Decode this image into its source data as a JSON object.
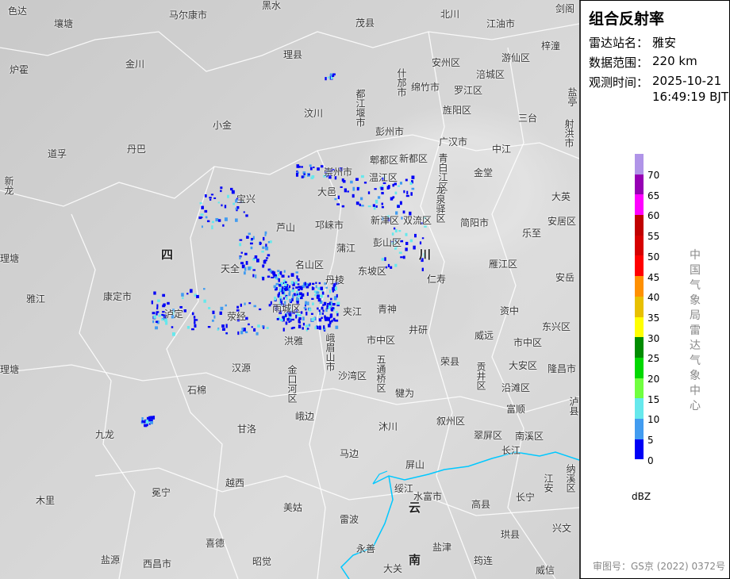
{
  "panel": {
    "title": "组合反射率",
    "station_label": "雷达站名：",
    "station": "雅安",
    "range_label": "数据范围：",
    "range": "220 km",
    "time_label": "观测时间：",
    "date": "2025-10-21",
    "time": "16:49:19 BJT",
    "legend": {
      "unit": "dBZ",
      "ticks": [
        "70",
        "65",
        "60",
        "55",
        "50",
        "45",
        "40",
        "35",
        "30",
        "25",
        "20",
        "15",
        "10",
        "5",
        "0"
      ],
      "colors": [
        "#b094e8",
        "#9600b4",
        "#ff00ff",
        "#c00000",
        "#d60000",
        "#ff0000",
        "#ff9000",
        "#e8c000",
        "#ffff00",
        "#008c00",
        "#00d800",
        "#70ff40",
        "#66e8ec",
        "#429cf0",
        "#0000f6"
      ]
    },
    "agency": "中国气象局雷达气象中心",
    "approval": "审图号：GS京 (2022) 0372号"
  },
  "map": {
    "places": [
      "色达",
      "壤塘",
      "马尔康市",
      "黑水",
      "茂县",
      "北川",
      "江油市",
      "剑阁",
      "炉霍",
      "金川",
      "理县",
      "安州区",
      "游仙区",
      "梓潼",
      "盐亭",
      "什邡市",
      "绵竹市",
      "罗江区",
      "涪城区",
      "汶川",
      "都江堰市",
      "旌阳区",
      "三台",
      "小金",
      "彭州市",
      "广汉市",
      "中江",
      "射洪市",
      "道孚",
      "丹巴",
      "郫都区",
      "新都区",
      "青白江区",
      "金堂",
      "新龙",
      "崇州市",
      "温江区",
      "宝兴",
      "大邑",
      "龙泉驿区",
      "大英",
      "新津区",
      "双流区",
      "芦山",
      "邛崃市",
      "简阳市",
      "安居区",
      "乐至",
      "彭山区",
      "蒲江",
      "四",
      "理塘",
      "川",
      "天全",
      "名山区",
      "东坡区",
      "雁江区",
      "丹棱",
      "仁寿",
      "安岳",
      "雅江",
      "康定市",
      "泸定",
      "雨城区",
      "夹江",
      "青神",
      "资中",
      "荥经",
      "东兴区",
      "井研",
      "威远",
      "市中区",
      "市中区",
      "洪雅",
      "峨眉山市",
      "五通桥区",
      "荣县",
      "贡井区",
      "大安区",
      "隆昌市",
      "汉源",
      "金口河区",
      "沙湾区",
      "理塘",
      "沿滩区",
      "犍为",
      "石棉",
      "富顺",
      "泸县",
      "九龙",
      "峨边",
      "叙州区",
      "甘洛",
      "沐川",
      "翠屏区",
      "南溪区",
      "长江",
      "马边",
      "屏山",
      "纳溪区",
      "越西",
      "绥江",
      "水富市",
      "江安",
      "木里",
      "冕宁",
      "美姑",
      "高县",
      "长宁",
      "云",
      "雷波",
      "兴文",
      "珙县",
      "喜德",
      "永善",
      "盐津",
      "盐源",
      "西昌市",
      "昭觉",
      "大关",
      "南",
      "筠连",
      "威信"
    ]
  }
}
